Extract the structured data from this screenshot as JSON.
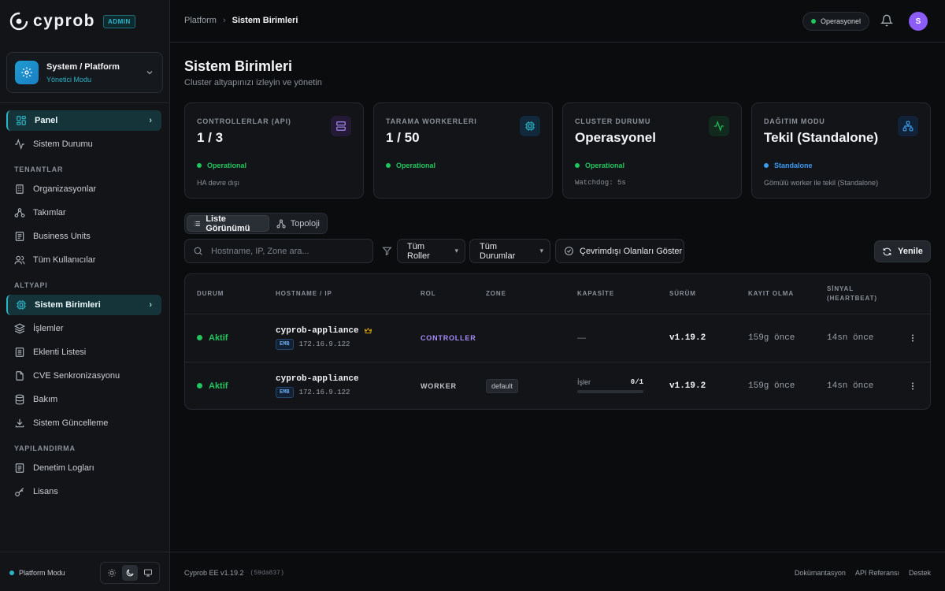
{
  "brand": {
    "name": "cyprob",
    "badge": "ADMIN"
  },
  "workspace": {
    "title": "System / Platform",
    "subtitle": "Yönetici Modu"
  },
  "sidebar": {
    "top_items": [
      {
        "label": "Panel"
      },
      {
        "label": "Sistem Durumu"
      }
    ],
    "sections": {
      "tenants": {
        "label": "TENANTLAR",
        "items": [
          "Organizasyonlar",
          "Takımlar",
          "Business Units",
          "Tüm Kullanıcılar"
        ]
      },
      "infra": {
        "label": "ALTYAPI",
        "items": [
          "Sistem Birimleri",
          "İşlemler",
          "Eklenti Listesi",
          "CVE Senkronizasyonu",
          "Bakım",
          "Sistem Güncelleme"
        ]
      },
      "config": {
        "label": "YAPILANDIRMA",
        "items": [
          "Denetim Logları",
          "Lisans"
        ]
      }
    },
    "footer": {
      "mode": "Platform Modu"
    }
  },
  "header": {
    "breadcrumb": [
      "Platform",
      "Sistem Birimleri"
    ],
    "status": "Operasyonel",
    "avatar": "S"
  },
  "page": {
    "title": "Sistem Birimleri",
    "subtitle": "Cluster altyapınızı izleyin ve yönetin"
  },
  "stats": [
    {
      "label": "CONTROLLERLAR (API)",
      "value": "1 / 3",
      "status": "Operational",
      "note": "HA devre dışı",
      "status_color": "#22c55e"
    },
    {
      "label": "TARAMA WORKERLERI",
      "value": "1 / 50",
      "status": "Operational",
      "note": "",
      "status_color": "#22c55e"
    },
    {
      "label": "CLUSTER DURUMU",
      "value": "Operasyonel",
      "status": "Operational",
      "note": "Watchdog: 5s",
      "status_color": "#22c55e"
    },
    {
      "label": "DAĞITIM MODU",
      "value": "Tekil (Standalone)",
      "status": "Standalone",
      "note": "Gömülü worker ile tekil (Standalone)",
      "status_color": "#3b9cf0"
    }
  ],
  "view_tabs": [
    "Liste Görünümü",
    "Topoloji"
  ],
  "filters": {
    "search_placeholder": "Hostname, IP, Zone ara...",
    "roles": "Tüm Roller",
    "statuses": "Tüm Durumlar",
    "offline": "Çevrimdışı Olanları Göster",
    "refresh": "Yenile"
  },
  "table": {
    "columns": [
      "DURUM",
      "HOSTNAME / IP",
      "ROL",
      "ZONE",
      "KAPASİTE",
      "SÜRÜM",
      "KAYIT OLMA",
      "SİNYAL (HEARTBEAT)"
    ],
    "rows": [
      {
        "status": "Aktif",
        "hostname": "cyprob-appliance",
        "tag": "EMB",
        "ip": "172.16.9.122",
        "role": "CONTROLLER",
        "zone": "",
        "capacity": "—",
        "version": "v1.19.2",
        "registered": "159g önce",
        "heartbeat": "14sn önce"
      },
      {
        "status": "Aktif",
        "hostname": "cyprob-appliance",
        "tag": "EMB",
        "ip": "172.16.9.122",
        "role": "WORKER",
        "zone": "default",
        "capacity_label": "İşler",
        "capacity_value": "0/1",
        "capacity_fraction": 0,
        "version": "v1.19.2",
        "registered": "159g önce",
        "heartbeat": "14sn önce"
      }
    ]
  },
  "footer": {
    "version": "Cyprob EE v1.19.2",
    "hash": "(59da837)",
    "links": [
      "Dokümantasyon",
      "API Referansı",
      "Destek"
    ]
  },
  "colors": {
    "accent": "#2bb3c6",
    "success": "#22c55e",
    "controller": "#a78bfa",
    "avatar": "#8b5cf6"
  }
}
